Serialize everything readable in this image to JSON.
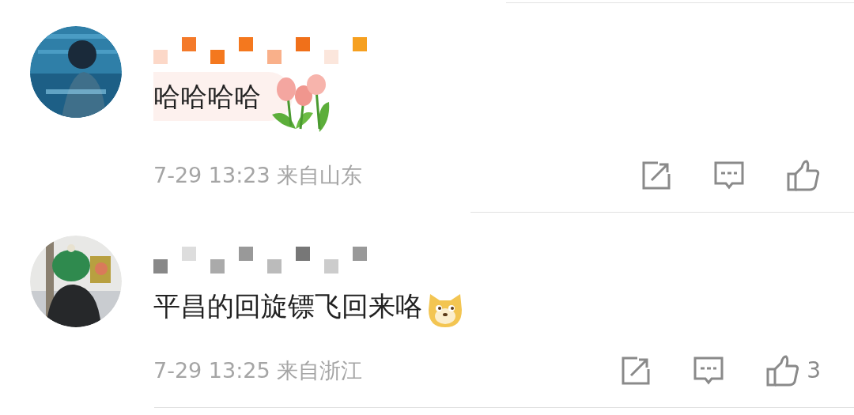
{
  "comments": [
    {
      "highlighted": true,
      "text": "哈哈哈哈",
      "sticker": {
        "kind": "tulips"
      },
      "meta": "7-29 13:23 来自山东"
    },
    {
      "highlighted": false,
      "text": "平昌的回旋镖飞回来咯",
      "sticker": {
        "kind": "dog"
      },
      "meta": "7-29 13:25 来自浙江",
      "likes": "3"
    }
  ]
}
